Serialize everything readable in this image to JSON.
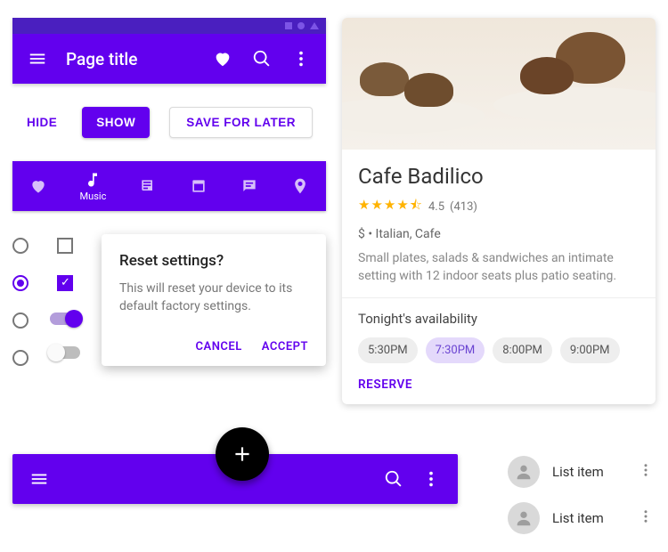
{
  "appbar": {
    "title": "Page title"
  },
  "buttons": {
    "hide": "HIDE",
    "show": "SHOW",
    "save": "SAVE FOR LATER"
  },
  "tabs": {
    "items": [
      {
        "label": ""
      },
      {
        "label": "Music"
      },
      {
        "label": ""
      },
      {
        "label": ""
      },
      {
        "label": ""
      },
      {
        "label": ""
      }
    ]
  },
  "dialog": {
    "title": "Reset settings?",
    "body": "This will reset your device to its default factory settings.",
    "cancel": "CANCEL",
    "accept": "ACCEPT"
  },
  "card": {
    "title": "Cafe Badilico",
    "rating_value": "4.5",
    "rating_count": "(413)",
    "price_category": "$ • Italian, Cafe",
    "description": "Small plates, salads & sandwiches an intimate setting with 12 indoor seats plus patio seating.",
    "availability_label": "Tonight's availability",
    "slots": [
      "5:30PM",
      "7:30PM",
      "8:00PM",
      "9:00PM"
    ],
    "selected_slot": 1,
    "reserve": "RESERVE"
  },
  "list": {
    "items": [
      "List item",
      "List item"
    ]
  }
}
